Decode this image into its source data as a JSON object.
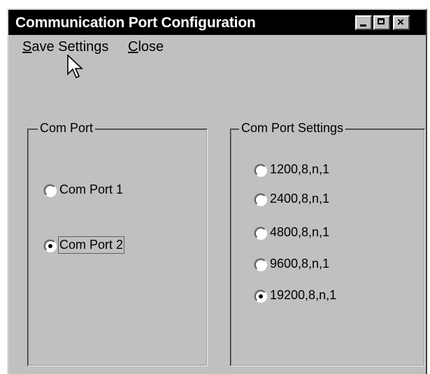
{
  "window": {
    "title": "Communication Port Configuration",
    "close_glyph": "×"
  },
  "menu": {
    "save_label": "Save Settings",
    "close_label": "Close"
  },
  "com_port": {
    "legend": "Com Port",
    "options": [
      {
        "label": "Com Port 1",
        "checked": false
      },
      {
        "label": "Com Port 2",
        "checked": true
      }
    ]
  },
  "com_settings": {
    "legend": "Com Port Settings",
    "options": [
      {
        "label": "1200,8,n,1",
        "checked": false
      },
      {
        "label": "2400,8,n,1",
        "checked": false
      },
      {
        "label": "4800,8,n,1",
        "checked": false
      },
      {
        "label": "9600,8,n,1",
        "checked": false
      },
      {
        "label": "19200,8,n,1",
        "checked": true
      }
    ]
  },
  "icons": {
    "pointer": "mouse-pointer-icon"
  }
}
